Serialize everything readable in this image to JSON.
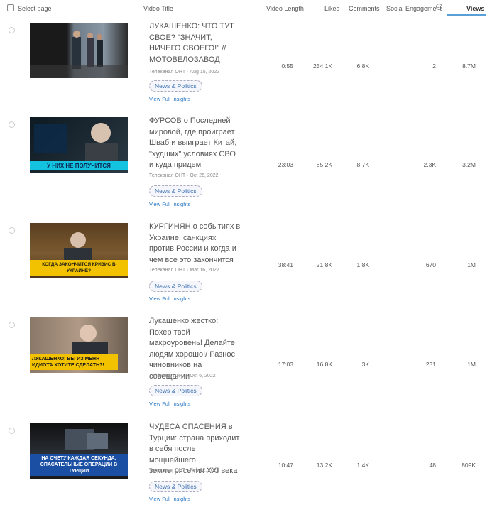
{
  "header": {
    "select_page": "Select page",
    "video_title": "Video Title",
    "video_length": "Video Length",
    "likes": "Likes",
    "comments": "Comments",
    "social_engagement": "Social Engagement",
    "info_glyph": "i",
    "views": "Views"
  },
  "rows": [
    {
      "title": "ЛУКАШЕНКО: ЧТО ТУТ СВОЕ? \"ЗНАЧИТ, НИЧЕГО СВОЕГО!\" // МОТОВЕЛОЗАВОД",
      "meta": "Телеканал ОНТ · Aug 15, 2022",
      "category": "News & Politics",
      "link": "View Full Insights",
      "length": "0:55",
      "likes": "254.1K",
      "comments": "6.8K",
      "social": "2",
      "views": "8.7M",
      "thumb_caption": ""
    },
    {
      "title": "ФУРСОВ о Последней мировой, где проиграет Шваб и выиграет Китай, \"худших\" условиях СВО и куда придем",
      "meta": "Телеканал ОНТ · Oct 26, 2022",
      "category": "News & Politics",
      "link": "View Full Insights",
      "length": "23:03",
      "likes": "85.2K",
      "comments": "8.7K",
      "social": "2.3K",
      "views": "3.2M",
      "thumb_caption": "У НИХ НЕ ПОЛУЧИТСЯ"
    },
    {
      "title": "КУРГИНЯН о событиях в Украине, санкциях против России и когда и чем все это закончится",
      "meta": "Телеканал ОНТ · Mar 16, 2022",
      "category": "News & Politics",
      "link": "View Full Insights",
      "length": "38:41",
      "likes": "21.8K",
      "comments": "1.8K",
      "social": "670",
      "views": "1M",
      "thumb_caption": "КОГДА ЗАКОНЧИТСЯ КРИЗИС В УКРАИНЕ?"
    },
    {
      "title": "Лукашенко жестко: Похер твой макроуровень! Делайте людям хорошо!/ Разнос чиновников на совещании",
      "meta": "Телеканал ОНТ · Oct 6, 2022",
      "category": "News & Politics",
      "link": "View Full Insights",
      "length": "17:03",
      "likes": "16.8K",
      "comments": "3K",
      "social": "231",
      "views": "1M",
      "thumb_caption": "ЛУКАШЕНКО: ВЫ ИЗ МЕНЯ ИДИОТА ХОТИТЕ СДЕЛАТЬ?!"
    },
    {
      "title": "ЧУДЕСА СПАСЕНИЯ в Турции: страна приходит в себя после мощнейшего землетрясения XXI века",
      "meta": "Телеканал ОНТ · Feb 12, 2023",
      "category": "News & Politics",
      "link": "View Full Insights",
      "length": "10:47",
      "likes": "13.2K",
      "comments": "1.4K",
      "social": "48",
      "views": "809K",
      "thumb_caption": "НА СЧЕТУ КАЖДАЯ СЕКУНДА. СПАСАТЕЛЬНЫЕ ОПЕРАЦИИ В ТУРЦИИ"
    }
  ],
  "colors": {
    "accent": "#5aa0d8",
    "link": "#2a78c2",
    "caption_yellow": "#f2c200",
    "caption_cyan": "#13c3e0",
    "caption_blue": "#1a4fa3"
  }
}
